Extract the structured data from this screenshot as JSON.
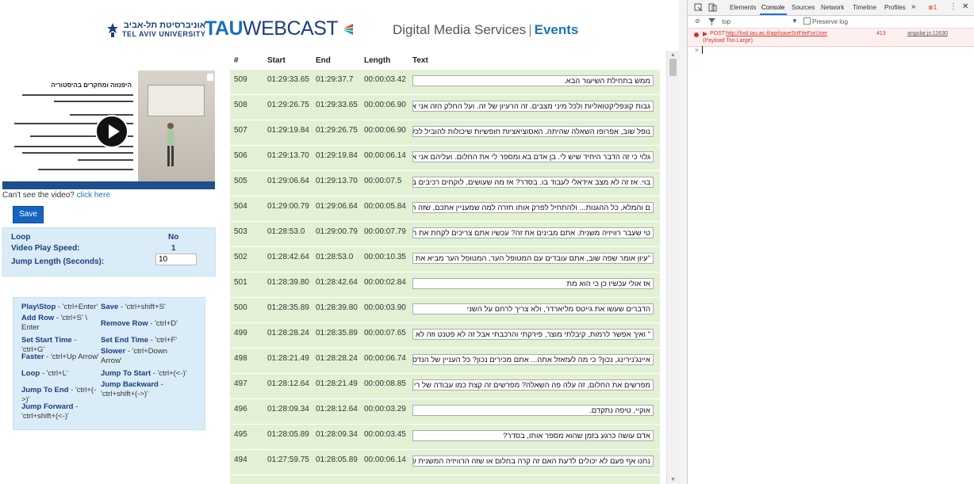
{
  "header": {
    "university_hebrew": "אוניברסיטת תל-אביב",
    "university_english": "TEL AVIV UNIVERSITY",
    "webcast_tau": "TAU",
    "webcast_rest": "WEBCAST",
    "site_title": "Digital Media Services",
    "site_separator": "|",
    "site_events": "Events"
  },
  "video": {
    "slide_title": "היפנוזה ומחקרים בהיסטוריה",
    "cant_see_text": "Can't see the video?",
    "click_here": "click here"
  },
  "save_button": "Save",
  "settings": {
    "loop_label": "Loop",
    "loop_value": "No",
    "speed_label": "Video Play Speed:",
    "speed_value": "1",
    "jump_label": "Jump Length (Seconds):",
    "jump_value": "10"
  },
  "shortcuts": {
    "play_stop": "Play\\Stop",
    "play_stop_key": " - 'ctrl+Enter'",
    "save": "Save",
    "save_key": " - 'ctrl+shift+S'",
    "add_row": "Add Row",
    "add_row_key": " - 'ctrl+S' \\ Enter",
    "remove_row": "Remove Row",
    "remove_row_key": " - 'ctrl+D'",
    "set_start": "Set Start Time",
    "set_start_key": " - 'ctrl+G'",
    "set_end": "Set End Time",
    "set_end_key": " - 'ctrl+F'",
    "faster": "Faster",
    "faster_key": " - 'ctrl+Up Arrow'",
    "slower": "Slower",
    "slower_key": " - 'ctrl+Down Arrow'",
    "loop": "Loop",
    "loop_key": " - 'ctrl+L'",
    "jump_to_start": "Jump To Start",
    "jump_to_start_key": " - 'ctrl+(<-)'",
    "jump_to_end": "Jump To End",
    "jump_to_end_key": " - 'ctrl+(->)'",
    "jump_backward": "Jump Backward",
    "jump_backward_key": " - 'ctrl+shift+(->)'",
    "jump_forward": "Jump Forward",
    "jump_forward_key": " - 'ctrl+shift+(<-)'"
  },
  "table": {
    "headers": {
      "num": "#",
      "start": "Start",
      "end": "End",
      "length": "Length",
      "text": "Text"
    },
    "rows": [
      {
        "num": "509",
        "start": "01:29:33.65",
        "end": "01:29:37.7",
        "length": "00:00:03.42",
        "text": "ממש בתחילת השיעור הבא."
      },
      {
        "num": "508",
        "start": "01:29:26.75",
        "end": "01:29:33.65",
        "length": "00:00:06.90",
        "text": "גבות קונפליקטואליות ולכל מיני מצבים. זה הרעיון של זה. ועל החלק הזה אני אדבר"
      },
      {
        "num": "507",
        "start": "01:29:19.84",
        "end": "01:29:26.75",
        "length": "00:00:06.90",
        "text": "נופל שוב, אפרופו השאלה שהיתה. האסוציאציות חופשיות שיכולות להוביל לכל מיני"
      },
      {
        "num": "506",
        "start": "01:29:13.70",
        "end": "01:29:19.84",
        "length": "00:00:06.14",
        "text": "גלוי כי זה הדבר היחיד שיש לי. בן אדם בא ומספר לי את החלום. ועליהם אני אוסף"
      },
      {
        "num": "505",
        "start": "01:29:06.64",
        "end": "01:29:13.70",
        "length": "00:00:07.5",
        "text": "בוי. אז זה לא מצב אידאלי לעבוד בו. בסדר? אז מה שעושים, לוקחים רכיבים בתוכן"
      },
      {
        "num": "504",
        "start": "01:29:00.79",
        "end": "01:29:06.64",
        "length": "00:00:05.84",
        "text": "ם והמלא, כל ההגנות... ולהתחיל לפרק אותו חזרה למה שמעניין אתכם, שזה התוכן"
      },
      {
        "num": "503",
        "start": "01:28:53.0",
        "end": "01:29:00.79",
        "length": "00:00:07.79",
        "text": "טי שעבר רוויזיה משנית. אתם מבינים את זה? עכשיו אתם צריכים לקחת את הדבר"
      },
      {
        "num": "502",
        "start": "01:28:42.64",
        "end": "01:28:53.0",
        "length": "00:00:10.35",
        "text": "\"עיון אומר שפה שוב, אתם עובדים עם המטופל הער, המטופל הער מביא את התוכן"
      },
      {
        "num": "501",
        "start": "01:28:39.80",
        "end": "01:28:42.64",
        "length": "00:00:02.84",
        "text": "אז אולי עכשיו כן כי הוא מת"
      },
      {
        "num": "500",
        "start": "01:28:35.89",
        "end": "01:28:39.80",
        "length": "00:00:03.90",
        "text": "הדברים שעשו את גייטס מליארדר, ולא צריך לרחם על השני"
      },
      {
        "num": "499",
        "start": "01:28:28.24",
        "end": "01:28:35.89",
        "length": "00:00:07.65",
        "text": "\" ואיך אפשר לרמות, קיבלתי מוצר, פירקתי והרכבתי אבל זה לא פטנט וזה לא ... כל"
      },
      {
        "num": "498",
        "start": "01:28:21.49",
        "end": "01:28:28.24",
        "length": "00:00:06.74",
        "text": "איינג'נירינג, נכון? כי מה לעזאזל אתה... אתם מכירים נכון? כל העניין של הנדסה"
      },
      {
        "num": "497",
        "start": "01:28:12.64",
        "end": "01:28:21.49",
        "length": "00:00:08.85",
        "text": "מפרשים את החלום, זה עלה פה השאלה? מפרשים זה קצת כמו עבודה של ריוורס"
      },
      {
        "num": "496",
        "start": "01:28:09.34",
        "end": "01:28:12.64",
        "length": "00:00:03.29",
        "text": "אוקיי, טיפה נתקדם."
      },
      {
        "num": "495",
        "start": "01:28:05.89",
        "end": "01:28:09.34",
        "length": "00:00:03.45",
        "text": "אדם עושה כרגע בזמן שהוא מספר אותו, בסדר?"
      },
      {
        "num": "494",
        "start": "01:27:59.75",
        "end": "01:28:05.89",
        "length": "00:00:06.14",
        "text": "נחנו אף פעם לא יכולים לדעת האם זה קרה בחלום או שזה הרוויזיה המשנית שהבן"
      }
    ]
  },
  "devtools": {
    "tabs": [
      "Elements",
      "Console",
      "Sources",
      "Network",
      "Timeline",
      "Profiles"
    ],
    "more": "»",
    "error_count": "1",
    "context": "top",
    "preserve_log": "Preserve log",
    "error_method": "POST",
    "error_url": "http://lool.tau.ac.il/api/saveSrtFileForUser",
    "error_code": "413",
    "error_detail": "(Payload Too Large)",
    "error_source": "angular.js:11630",
    "prompt": ">"
  },
  "colors": {
    "accent": "#1b75bc",
    "row_bg": "#e2f1d4",
    "panel_bg": "#daecf7",
    "error": "#d93025"
  }
}
